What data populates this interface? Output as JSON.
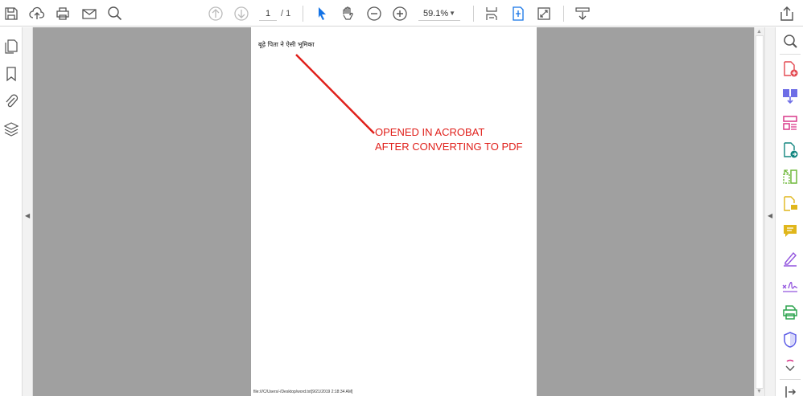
{
  "toolbar": {
    "page_current": "1",
    "page_total": "/ 1",
    "zoom": "59.1%"
  },
  "document": {
    "line1": "बूढ़े पिता ने ऐसी भूमिका",
    "footer": "file:///C/Users/-/Desktop/word.txt[9/21/2019 2:18:34 AM]"
  },
  "annotation": {
    "line1": "OPENED IN ACROBAT",
    "line2": "AFTER CONVERTING TO PDF",
    "color": "#e0201b"
  }
}
